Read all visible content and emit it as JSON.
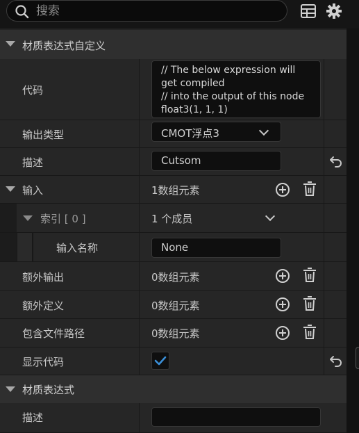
{
  "toolbar": {
    "search_placeholder": "搜索",
    "icons": [
      "search-icon",
      "table-icon",
      "gear-icon"
    ]
  },
  "section_main": {
    "title": "材质表达式自定义",
    "code": {
      "label": "代码",
      "value": "// The below expression will\nget compiled\n// into the output of this node\nfloat3(1, 1, 1)"
    },
    "output_type": {
      "label": "输出类型",
      "value": "CMOT浮点3"
    },
    "description": {
      "label": "描述",
      "value": "Cutsom"
    },
    "inputs": {
      "label": "输入",
      "summary": "1数组元素",
      "index": {
        "label": "索引 [ 0 ]",
        "summary": "1 个成员"
      },
      "input_name": {
        "label": "输入名称",
        "value": "None"
      }
    },
    "additional_outputs": {
      "label": "额外输出",
      "summary": "0数组元素"
    },
    "additional_defines": {
      "label": "额外定义",
      "summary": "0数组元素"
    },
    "include_file_paths": {
      "label": "包含文件路径",
      "summary": "0数组元素"
    },
    "show_code": {
      "label": "显示代码",
      "checked": true
    }
  },
  "section_expr": {
    "title": "材质表达式",
    "description": {
      "label": "描述",
      "value": ""
    }
  },
  "colors": {
    "accent": "#3a8fd8",
    "background": "#232323",
    "field": "#0f0f0f"
  }
}
